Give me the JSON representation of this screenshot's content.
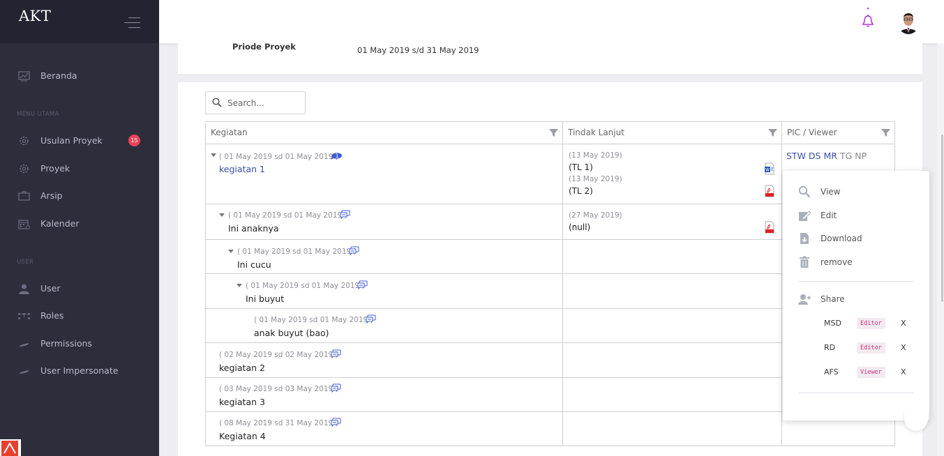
{
  "app": {
    "logo": "AKT"
  },
  "sidebar": {
    "sections": [
      "MENU UTAMA",
      "USER"
    ],
    "items": [
      {
        "label": "Beranda",
        "icon": "chart-icon"
      },
      {
        "label": "Usulan Proyek",
        "icon": "gear-icon",
        "badge": "15"
      },
      {
        "label": "Proyek",
        "icon": "gear-icon"
      },
      {
        "label": "Arsip",
        "icon": "briefcase-icon"
      },
      {
        "label": "Kalender",
        "icon": "calendar-icon"
      },
      {
        "label": "User",
        "icon": "user-icon"
      },
      {
        "label": "Roles",
        "icon": "network-icon"
      },
      {
        "label": "Permissions",
        "icon": "key-icon"
      },
      {
        "label": "User Impersonate",
        "icon": "key-icon"
      }
    ]
  },
  "project": {
    "period_label": "Priode Proyek",
    "period_value": "01 May 2019 s/d 31 May 2019"
  },
  "search": {
    "placeholder": "Search..."
  },
  "table": {
    "headers": [
      "Kegiatan",
      "Tindak Lanjut",
      "PIC / Viewer"
    ],
    "rows": [
      {
        "date": "( 01 May 2019 sd 01 May 2019 )",
        "title": "kegiatan 1",
        "badge": "1",
        "followups": [
          {
            "date": "(13 May 2019)",
            "text": "(TL 1)",
            "file": "word"
          },
          {
            "date": "(13 May 2019)",
            "text": "(TL 2)",
            "file": "pdf"
          }
        ],
        "pic": [
          "STW",
          "DS",
          "MR"
        ],
        "viewers": [
          "TG",
          "NP"
        ]
      },
      {
        "date": "( 01 May 2019 sd 01 May 2019 )",
        "title": "Ini anaknya",
        "followups": [
          {
            "date": "(27 May 2019)",
            "text": "(null)",
            "file": "pdf"
          }
        ]
      },
      {
        "date": "( 01 May 2019 sd 01 May 2019 )",
        "title": "Ini cucu"
      },
      {
        "date": "( 01 May 2019 sd 01 May 2019 )",
        "title": "Ini buyut"
      },
      {
        "date": "( 01 May 2019 sd 01 May 2019 )",
        "title": "anak buyut (bao)"
      },
      {
        "date": "( 02 May 2019 sd 02 May 2019 )",
        "title": "kegiatan 2"
      },
      {
        "date": "( 03 May 2019 sd 03 May 2019 )",
        "title": "kegiatan 3"
      },
      {
        "date": "( 08 May 2019 sd 31 May 2019 )",
        "title": "Kegiatan 4"
      }
    ]
  },
  "context_menu": {
    "items": [
      "View",
      "Edit",
      "Download",
      "remove"
    ],
    "share_label": "Share",
    "shares": [
      {
        "user": "MSD",
        "role": "Editor",
        "remove": "X"
      },
      {
        "user": "RD",
        "role": "Editor",
        "remove": "X"
      },
      {
        "user": "AFS",
        "role": "Viewer",
        "remove": "X"
      }
    ]
  },
  "colors": {
    "sidebar": "#2d2d3c",
    "accent": "#3a4fa8",
    "badge": "#e9435a",
    "bell": "#b030d0",
    "role_tag": "#d0327a"
  }
}
